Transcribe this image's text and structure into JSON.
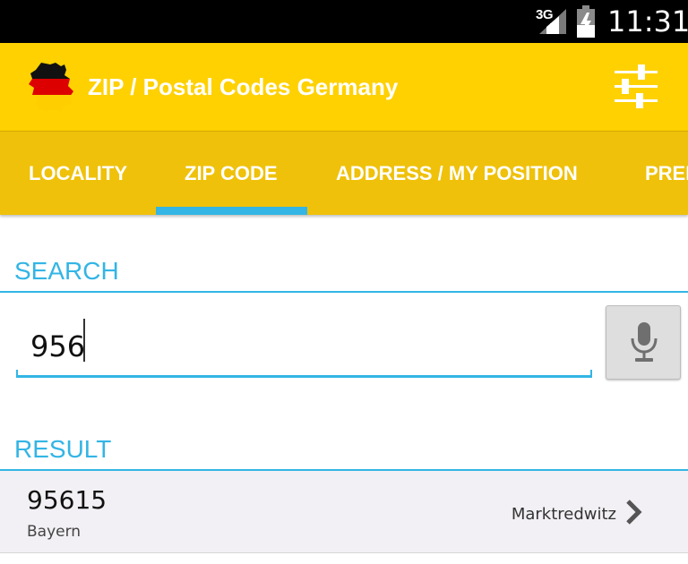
{
  "status_bar": {
    "network": "3G",
    "time": "11:31"
  },
  "app_bar": {
    "title": "ZIP / Postal Codes Germany",
    "logo_icon": "germany-flag-map-icon",
    "filter_icon": "sliders-icon",
    "colors": {
      "background": "#FFD100",
      "title": "#FFFFFF"
    }
  },
  "tabs": [
    {
      "label": "LOCALITY",
      "selected": false
    },
    {
      "label": "ZIP CODE",
      "selected": true
    },
    {
      "label": "ADDRESS / MY POSITION",
      "selected": false
    },
    {
      "label": "PREF",
      "selected": false
    }
  ],
  "tab_colors": {
    "background": "#EFC10A",
    "indicator": "#33B5E5"
  },
  "search": {
    "header": "SEARCH",
    "value": "956",
    "mic_icon": "microphone-icon"
  },
  "result": {
    "header": "RESULT",
    "items": [
      {
        "zip": "95615",
        "state": "Bayern",
        "city": "Marktredwitz",
        "chevron_icon": "chevron-right-icon"
      }
    ]
  },
  "accent_color": "#33B5E5"
}
